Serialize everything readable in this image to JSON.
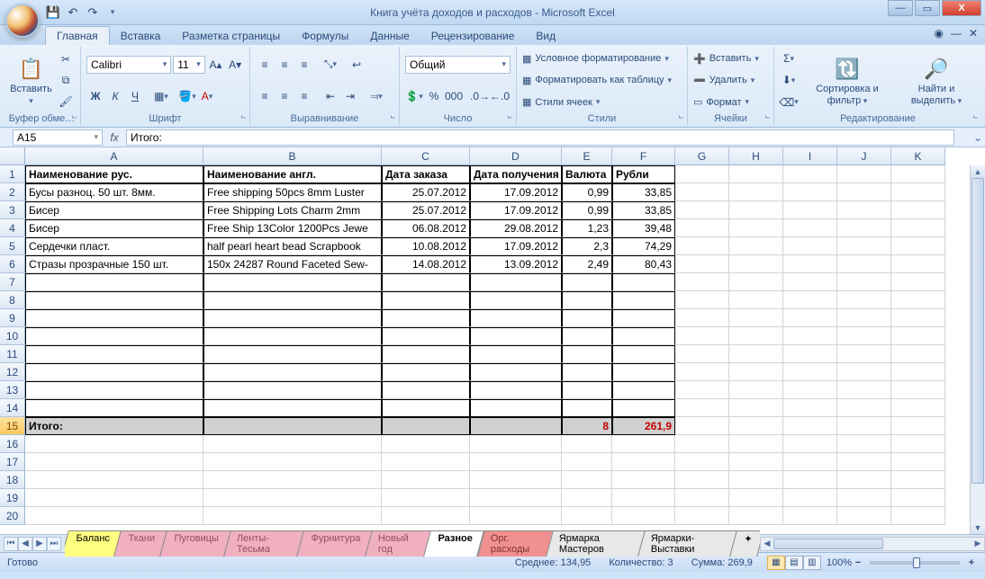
{
  "window": {
    "title": "Книга учёта доходов и расходов - Microsoft Excel"
  },
  "tabs": {
    "home": "Главная",
    "insert": "Вставка",
    "page_layout": "Разметка страницы",
    "formulas": "Формулы",
    "data": "Данные",
    "review": "Рецензирование",
    "view": "Вид"
  },
  "ribbon": {
    "clipboard": {
      "paste": "Вставить",
      "label": "Буфер обме…"
    },
    "font": {
      "name": "Calibri",
      "size": "11",
      "label": "Шрифт",
      "bold": "Ж",
      "italic": "К",
      "underline": "Ч"
    },
    "alignment": {
      "label": "Выравнивание"
    },
    "number": {
      "format": "Общий",
      "label": "Число"
    },
    "styles": {
      "conditional": "Условное форматирование",
      "table": "Форматировать как таблицу",
      "cell": "Стили ячеек",
      "label": "Стили"
    },
    "cells": {
      "insert": "Вставить",
      "delete": "Удалить",
      "format": "Формат",
      "label": "Ячейки"
    },
    "editing": {
      "sort": "Сортировка и фильтр",
      "find": "Найти и выделить",
      "label": "Редактирование"
    }
  },
  "namebox": "A15",
  "formula": "Итого:",
  "columns": [
    "A",
    "B",
    "C",
    "D",
    "E",
    "F",
    "G",
    "H",
    "I",
    "J",
    "K"
  ],
  "headers": {
    "a": "Наименование рус.",
    "b": "Наименование англ.",
    "c": "Дата заказа",
    "d": "Дата получения",
    "e": "Валюта",
    "f": "Рубли"
  },
  "rows": [
    {
      "n": 2,
      "a": "Бусы разноц. 50 шт. 8мм.",
      "b": "Free shipping 50pcs 8mm Luster",
      "c": "25.07.2012",
      "d": "17.09.2012",
      "e": "0,99",
      "f": "33,85"
    },
    {
      "n": 3,
      "a": "Бисер",
      "b": "Free Shipping Lots Charm 2mm",
      "c": "25.07.2012",
      "d": "17.09.2012",
      "e": "0,99",
      "f": "33,85"
    },
    {
      "n": 4,
      "a": "Бисер",
      "b": "Free Ship 13Color 1200Pcs Jewe",
      "c": "06.08.2012",
      "d": "29.08.2012",
      "e": "1,23",
      "f": "39,48"
    },
    {
      "n": 5,
      "a": "Сердечки пласт.",
      "b": "half pearl heart bead Scrapbook",
      "c": "10.08.2012",
      "d": "17.09.2012",
      "e": "2,3",
      "f": "74,29"
    },
    {
      "n": 6,
      "a": "Стразы прозрачные 150 шт.",
      "b": "150x 24287 Round Faceted Sew-",
      "c": "14.08.2012",
      "d": "13.09.2012",
      "e": "2,49",
      "f": "80,43"
    }
  ],
  "totals": {
    "row": 15,
    "label": "Итого:",
    "e": "8",
    "f": "261,9"
  },
  "sheets": {
    "balance": "Баланс",
    "fabrics": "Ткани",
    "buttons": "Пуговицы",
    "ribbons": "Ленты-Тесьма",
    "furniture": "Фурнитура",
    "newyear": "Новый год",
    "misc": "Разное",
    "org": "Орг. расходы",
    "masters": "Ярмарка Мастеров",
    "fairs": "Ярмарки-Выставки"
  },
  "status": {
    "ready": "Готово",
    "avg_label": "Среднее:",
    "avg": "134,95",
    "count_label": "Количество:",
    "count": "3",
    "sum_label": "Сумма:",
    "sum": "269,9",
    "zoom": "100%"
  }
}
